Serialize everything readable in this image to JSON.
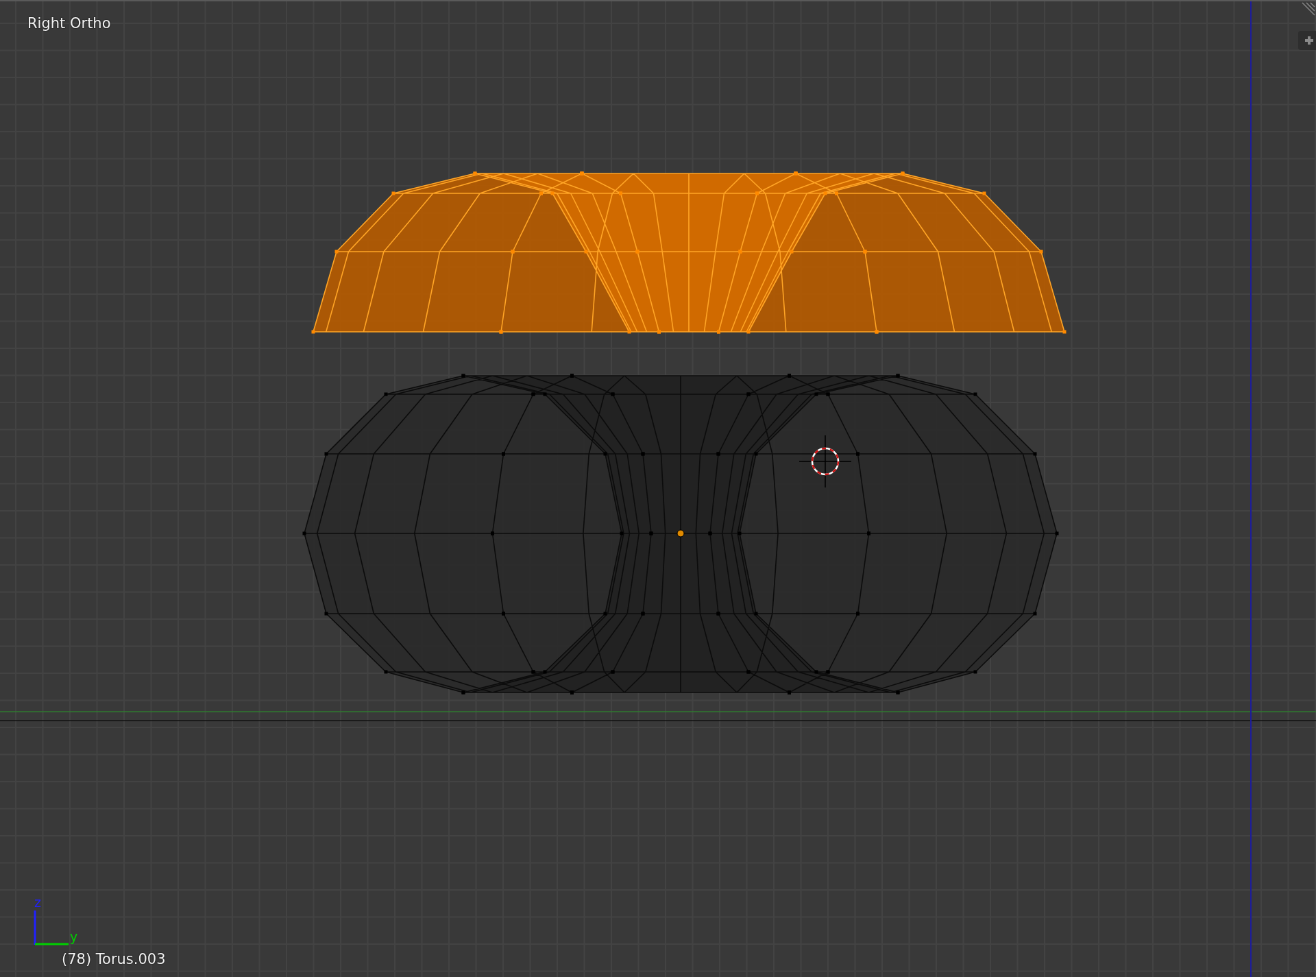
{
  "viewport": {
    "view_name": "Right Ortho",
    "status": "(78) Torus.003"
  },
  "axis_gizmo": {
    "vertical_label": "z",
    "horizontal_label": "y"
  },
  "objects": [
    {
      "selected": true
    },
    {
      "selected": false
    }
  ]
}
